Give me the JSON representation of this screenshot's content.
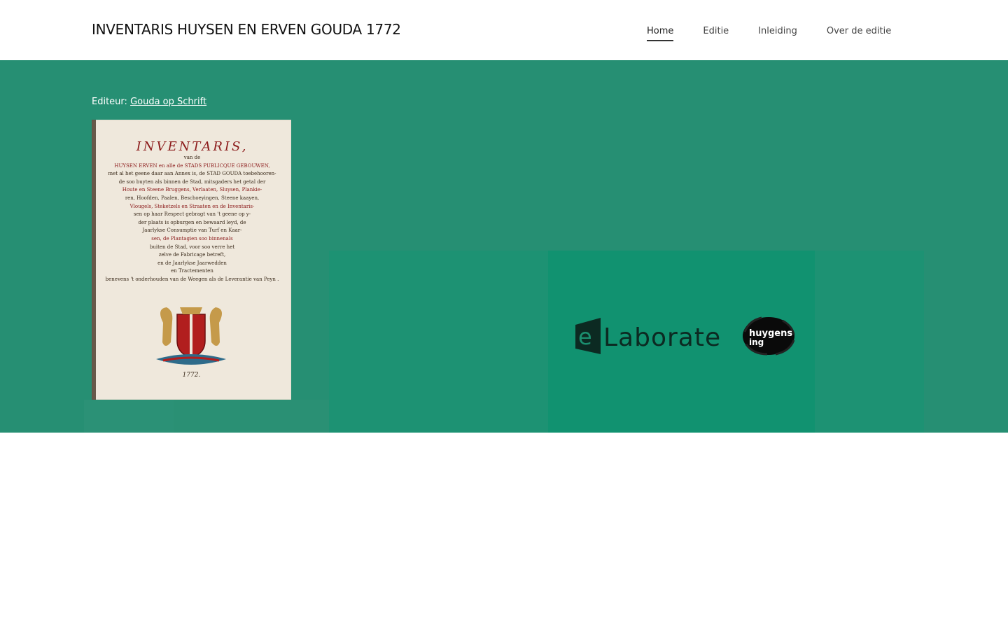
{
  "header": {
    "site_title": "INVENTARIS HUYSEN EN ERVEN GOUDA 1772",
    "nav": [
      {
        "label": "Home",
        "active": true
      },
      {
        "label": "Editie",
        "active": false
      },
      {
        "label": "Inleiding",
        "active": false
      },
      {
        "label": "Over de editie",
        "active": false
      }
    ]
  },
  "hero": {
    "editor_label": "Editeur:",
    "editor_link": "Gouda op Schrift",
    "cover": {
      "title": "INVENTARIS,",
      "lines": [
        "van de",
        "HUYSEN ERVEN en alle de STADS PUBLICQUE GEBOUWEN,",
        "met al het geene daar aan Annex is, de STAD GOUDA toebehooren-",
        "de soo buyten als binnen de Stad, mitsgaders het getal der",
        "Houte en Steene Bruggens, Verlaaten, Sluysen, Plankie-",
        "ren, Hoofden, Paalen, Beschoeyingen, Steene kaayen,",
        "Vlougels, Steketzels en Straaten en de Inventaris-",
        "sen op haar Respect gebragt van 't geene op y-",
        "der plaats is opburgen en bewaard leyd, de",
        "Jaarlykse Consumptie van Turf en Kaar-",
        "sen, de Plantagien soo binnenals",
        "buiten de Stad, voor soo verre het",
        "zelve de Fabricage betreft,",
        "en de Jaarlykse Jaarwedden",
        "en Tractementen",
        "benevens 't onderhouden van de Weegen als de Leverantie van Peyn ."
      ],
      "year": "1772."
    },
    "logos": {
      "elaborate": "eLaborate",
      "huygens": "huygens ing"
    }
  },
  "colors": {
    "hero_bg": "#268f73",
    "panel_bg": "#119270",
    "cover_red": "#8b1a1a"
  }
}
